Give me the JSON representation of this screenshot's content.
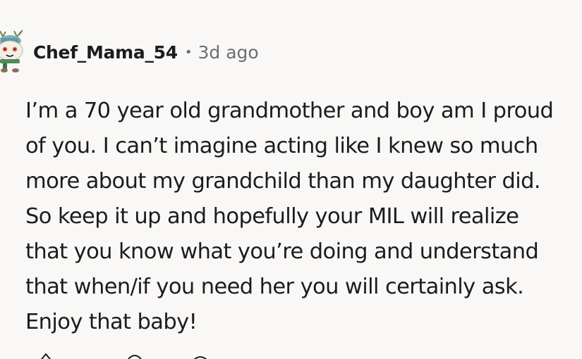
{
  "comment": {
    "author": "Chef_Mama_54",
    "separator": "•",
    "timestamp": "3d ago",
    "avatar_icon": "chef-snoo-avatar-icon",
    "body_lines": [
      "I’m a 70 year old grandmother and boy am I proud",
      "of you. I can’t imagine acting like I knew so much",
      "more about my grandchild than my daughter did.",
      "So keep it up and hopefully your MIL will realize",
      "that you know what you’re doing and understand",
      "that when/if you need her you will certainly ask.",
      "Enjoy that baby!"
    ]
  },
  "actions": {
    "upvote_icon": "upvote-icon",
    "downvote_icon": "downvote-icon",
    "reply_icon": "reply-icon"
  },
  "colors": {
    "background": "#f9f8f7",
    "text": "#1c1c1c",
    "meta": "#6b6e70"
  }
}
